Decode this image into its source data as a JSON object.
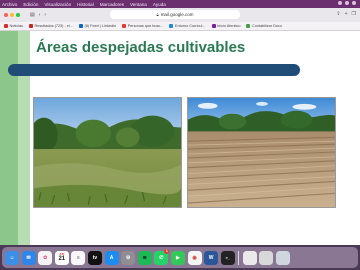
{
  "menubar": {
    "items": [
      "Archivo",
      "Edición",
      "Visualización",
      "Historial",
      "Marcadores",
      "Ventana",
      "Ayuda"
    ]
  },
  "browser": {
    "url": "mail.google.com",
    "bookmarks": [
      {
        "label": "Noticias",
        "color": "#d32f2f"
      },
      {
        "label": "Resultados (723) - el...",
        "color": "#c62828"
      },
      {
        "label": "(8) Feed | LinkedIn",
        "color": "#0a66c2"
      },
      {
        "label": "Personas que busc...",
        "color": "#e53935"
      },
      {
        "label": "Entorno Curricul...",
        "color": "#1e88e5"
      },
      {
        "label": "Inicio Atentico",
        "color": "#7b1fa2"
      },
      {
        "label": "Contabilizar Docu",
        "color": "#43a047"
      }
    ]
  },
  "slide": {
    "title": "Áreas despejadas cultivables",
    "title_color": "#2c7a55",
    "rule_color": "#1f4d78",
    "accent_color": "#8dc68b"
  },
  "dock": {
    "apps": [
      {
        "name": "finder-icon",
        "glyph": "☺",
        "color": "#3b8fe6"
      },
      {
        "name": "mail-icon",
        "glyph": "✉",
        "color": "#2f85e8"
      },
      {
        "name": "photos-icon",
        "glyph": "✿",
        "color": "#f4f4f4"
      },
      {
        "name": "calendar-icon",
        "glyph": "21",
        "color": "#ffffff"
      },
      {
        "name": "reminders-icon",
        "glyph": "≡",
        "color": "#f8f8f8"
      },
      {
        "name": "appletv-icon",
        "glyph": "tv",
        "color": "#111111"
      },
      {
        "name": "appstore-icon",
        "glyph": "A",
        "color": "#1c8cf0"
      },
      {
        "name": "settings-icon",
        "glyph": "⚙",
        "color": "#8e8e93"
      },
      {
        "name": "spotify-icon",
        "glyph": "≋",
        "color": "#1db954"
      },
      {
        "name": "whatsapp-icon",
        "glyph": "✆",
        "color": "#25d366",
        "badge": "1"
      },
      {
        "name": "facetime-icon",
        "glyph": "▶",
        "color": "#34c759"
      },
      {
        "name": "chrome-icon",
        "glyph": "◉",
        "color": "#f5f5f5"
      },
      {
        "name": "word-icon",
        "glyph": "W",
        "color": "#2b579a"
      },
      {
        "name": "terminal-icon",
        "glyph": ">_",
        "color": "#222222"
      }
    ],
    "calendar_month": "JUN",
    "calendar_day": "21",
    "whatsapp_badge": "1"
  }
}
